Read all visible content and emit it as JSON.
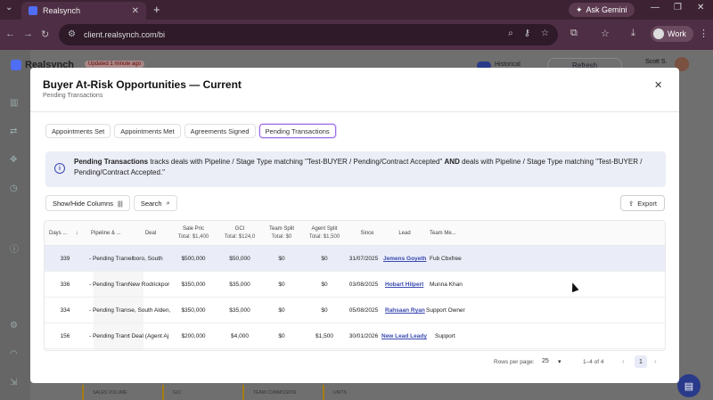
{
  "browser": {
    "tab_title": "Realsynch",
    "url": "client.realsynch.com/bi",
    "gemini_label": "Ask Gemini",
    "profile_label": "Work"
  },
  "app": {
    "brand": "Realsynch",
    "updated_badge": "Updated 1 minute ago",
    "historical_label": "Historical",
    "refresh_label": "Refresh",
    "user_name": "Scott S.",
    "bottom_tabs": [
      "SALES VOLUME",
      "GCI",
      "TEAM COMMISSION",
      "UNITS"
    ]
  },
  "modal": {
    "title": "Buyer At-Risk Opportunities — Current",
    "subtitle": "Pending Transactions",
    "tabs": [
      "Appointments Set",
      "Appointments Met",
      "Agreements Signed",
      "Pending Transactions"
    ],
    "active_tab": "Pending Transactions",
    "info": {
      "bold_label": "Pending Transactions",
      "text1": " tracks deals with Pipeline / Stage Type matching \"Test-BUYER / Pending/Contract Accepted\" ",
      "and": "AND",
      "text2": " deals with Pipeline / Stage Type matching \"Test-BUYER / Pending/Contract Accepted.\""
    },
    "toolbar": {
      "show_hide": "Show/Hide Columns",
      "search": "Search",
      "export": "Export"
    },
    "columns": {
      "days": "Days ...",
      "pipeline": "Pipeline & ...",
      "deal": "Deal",
      "sale_price": "Sale Pric",
      "sale_price_total": "Total: $1,400",
      "gci": "GCI",
      "gci_total": "Total: $124,0",
      "team_split": "Team Split",
      "team_split_total": "Total: $0",
      "agent_split": "Agent Split",
      "agent_split_total": "Total: $1,500",
      "since": "Since",
      "lead": "Lead",
      "team_member": "Team Me..."
    },
    "rows": [
      {
        "days": "339",
        "pipeline": "- Pending Transs",
        "deal": "elboro, South",
        "sale_price": "$500,000",
        "gci": "$50,000",
        "team_split": "$0",
        "agent_split": "$0",
        "since": "31/07/2025",
        "lead": "Jemens Goyeth",
        "team_member": "Fub Cbxfree"
      },
      {
        "days": "336",
        "pipeline": "- Pending Trans",
        "deal": "New Rodrickpor",
        "sale_price": "$350,000",
        "gci": "$35,000",
        "team_split": "$0",
        "agent_split": "$0",
        "since": "03/08/2025",
        "lead": "Hobart Hilpert",
        "team_member": "Munna Khan"
      },
      {
        "days": "334",
        "pipeline": "- Pending Trans",
        "deal": "se, South Alden,",
        "sale_price": "$350,000",
        "gci": "$35,000",
        "team_split": "$0",
        "agent_split": "$0",
        "since": "05/08/2025",
        "lead": "Rahsaan Ryan",
        "team_member": "Support Owner"
      },
      {
        "days": "156",
        "pipeline": "- Pending Trans",
        "deal": "t Deal (Agent Aj",
        "sale_price": "$200,000",
        "gci": "$4,000",
        "team_split": "$0",
        "agent_split": "$1,500",
        "since": "30/01/2026",
        "lead": "New Lead Leady",
        "team_member": "Support"
      }
    ],
    "pagination": {
      "rows_per_page_label": "Rows per page:",
      "rows_per_page": "25",
      "range": "1–4 of 4",
      "page": "1"
    }
  }
}
